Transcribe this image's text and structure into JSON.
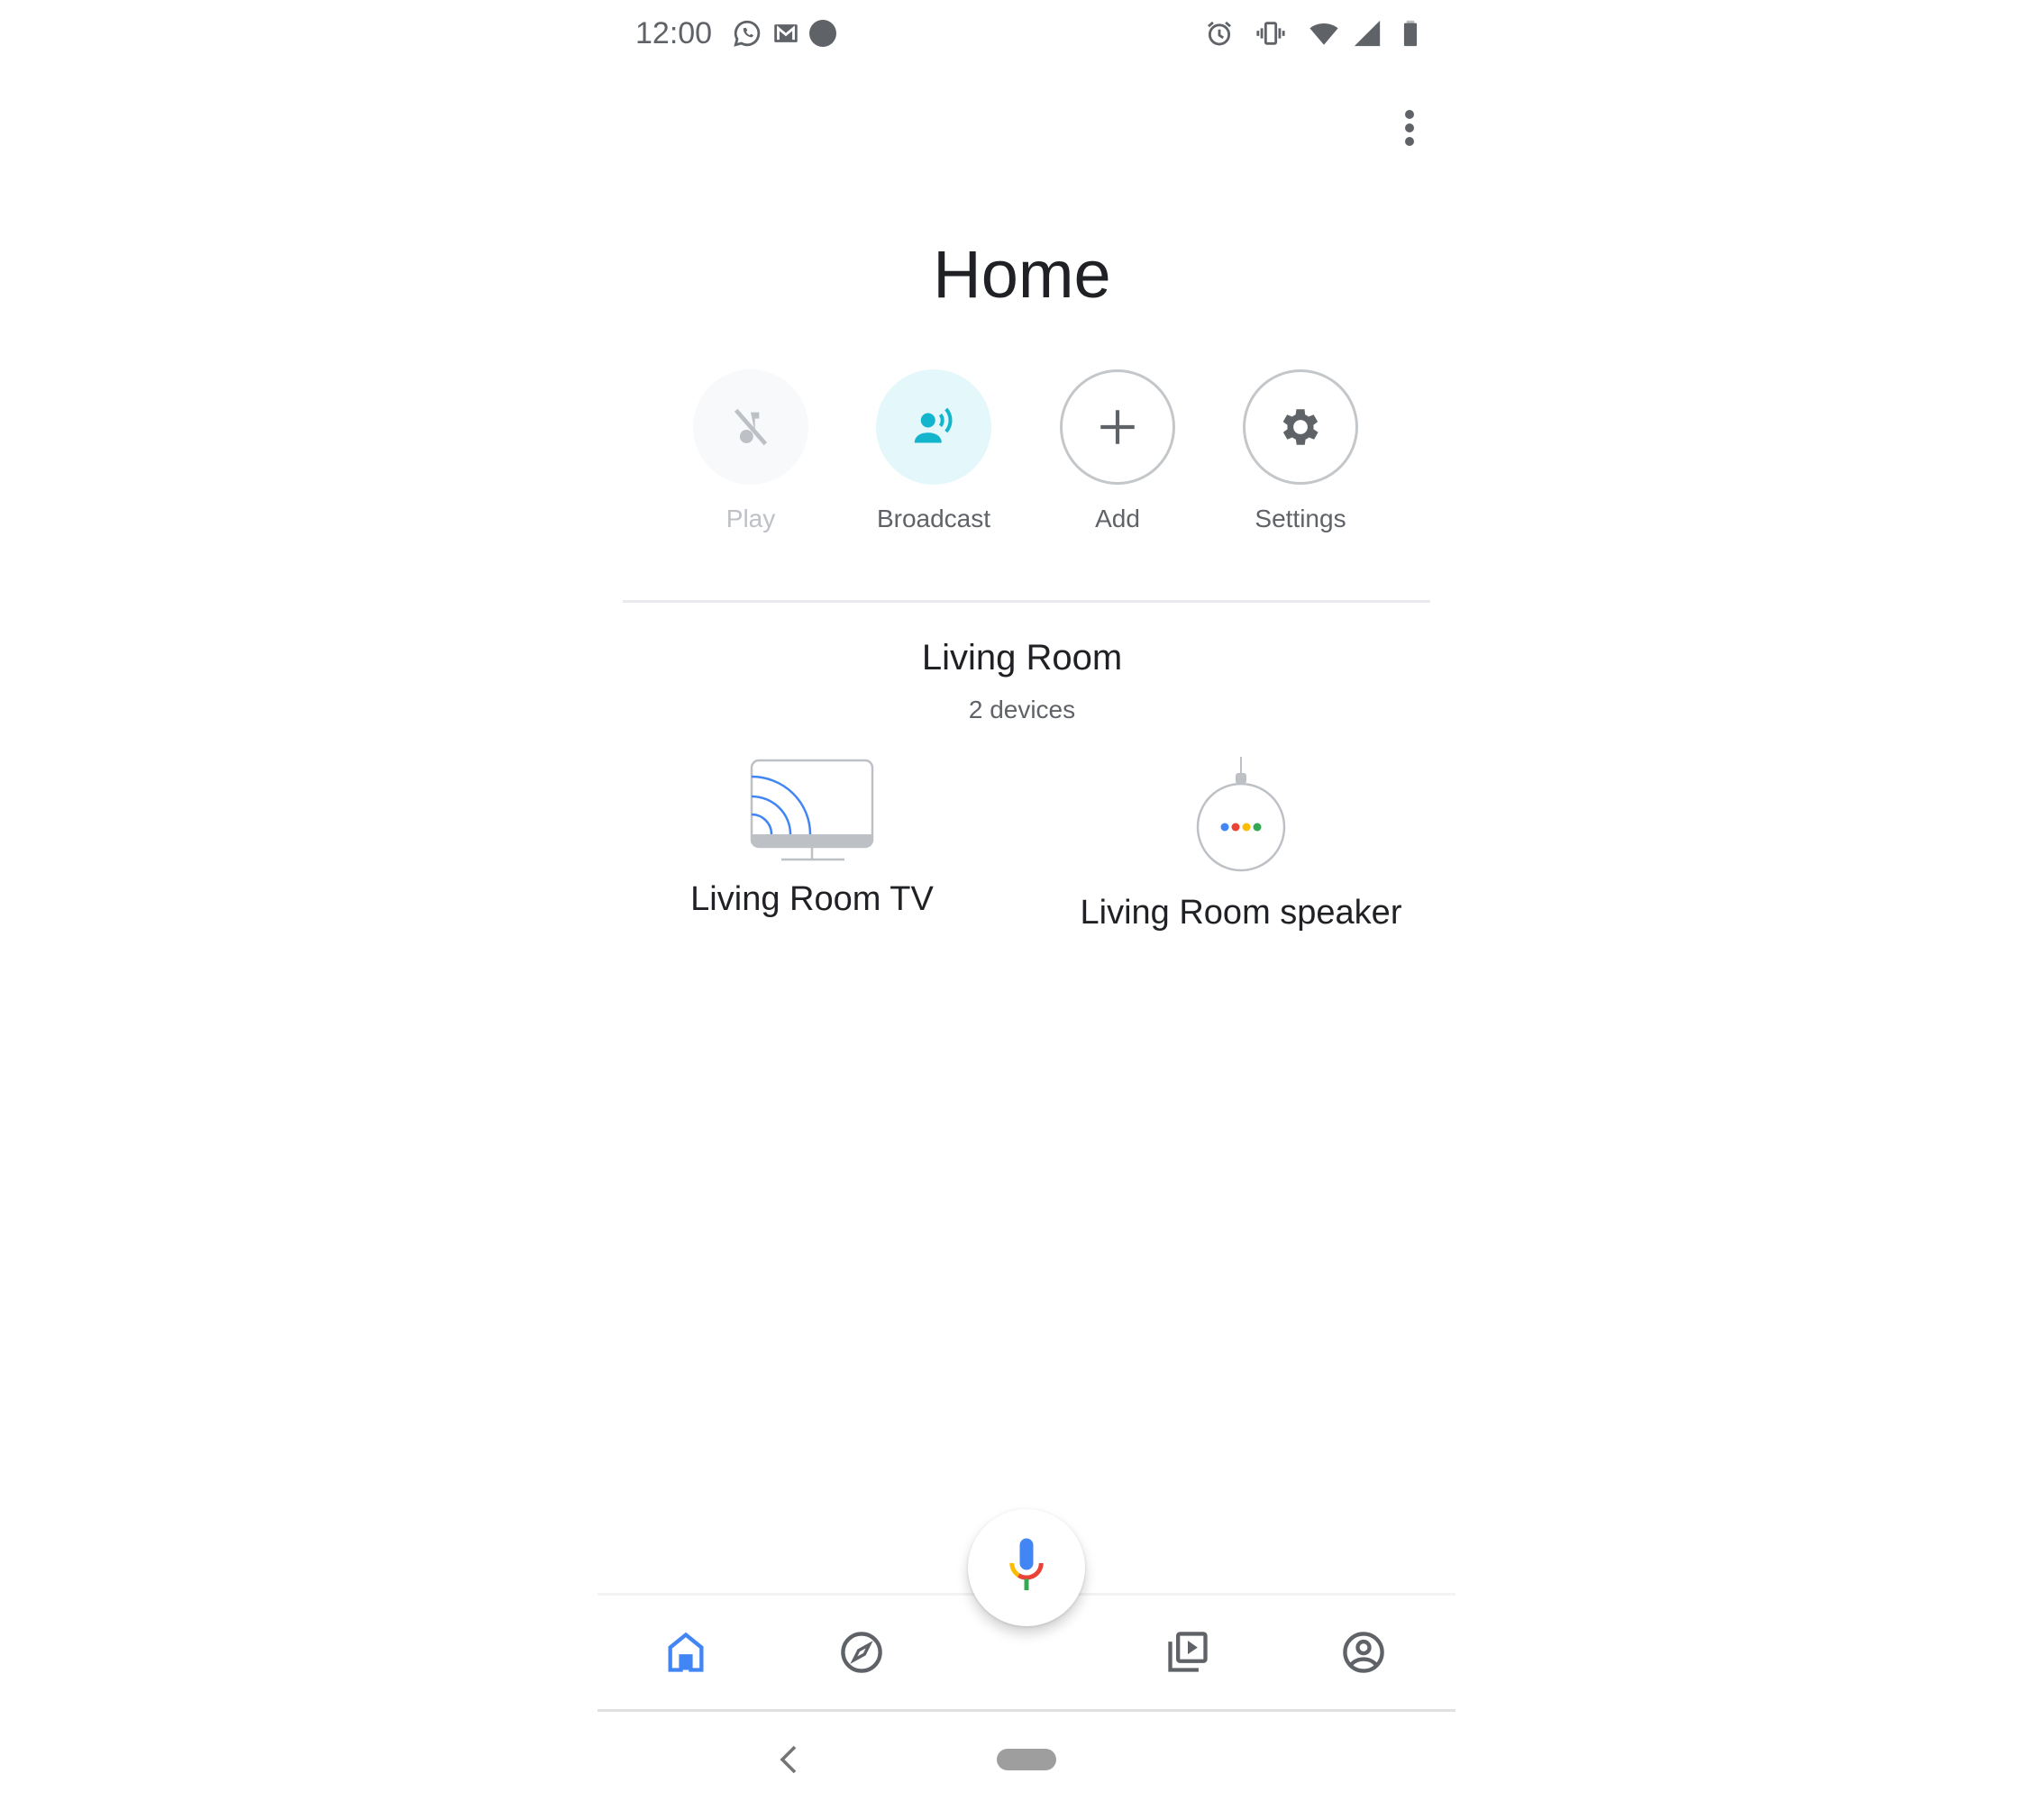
{
  "status_bar": {
    "time": "12:00",
    "left_icons": [
      "whatsapp-icon",
      "gmail-icon",
      "notification-dot-icon"
    ],
    "right_icons": [
      "alarm-icon",
      "vibrate-icon",
      "wifi-icon",
      "signal-icon",
      "battery-icon"
    ]
  },
  "header": {
    "more_icon": "more-vert-icon",
    "title": "Home"
  },
  "actions": [
    {
      "label": "Play",
      "icon": "music-off-icon",
      "state": "disabled"
    },
    {
      "label": "Broadcast",
      "icon": "broadcast-icon",
      "state": "active"
    },
    {
      "label": "Add",
      "icon": "plus-icon",
      "state": "normal"
    },
    {
      "label": "Settings",
      "icon": "gear-icon",
      "state": "normal"
    }
  ],
  "room": {
    "name": "Living Room",
    "subtitle": "2 devices",
    "devices": [
      {
        "label": "Living Room TV",
        "icon": "chromecast-tv-icon"
      },
      {
        "label": "Living Room speaker",
        "icon": "google-home-mini-icon"
      }
    ]
  },
  "bottom_nav": {
    "fab_icon": "google-mic-icon",
    "items": [
      {
        "name": "home",
        "icon": "home-icon",
        "active": true
      },
      {
        "name": "discover",
        "icon": "compass-icon",
        "active": false
      },
      {
        "name": "media",
        "icon": "media-library-icon",
        "active": false
      },
      {
        "name": "account",
        "icon": "account-circle-icon",
        "active": false
      }
    ]
  },
  "system_nav": {
    "back_icon": "back-chevron-icon",
    "home_icon": "home-pill"
  },
  "colors": {
    "accent_blue": "#4285f4",
    "broadcast_teal": "#12b5cb",
    "broadcast_bg": "#e4f7fb",
    "icon_gray": "#5f6368",
    "google_red": "#ea4335",
    "google_yellow": "#fbbc04",
    "google_green": "#34a853"
  }
}
